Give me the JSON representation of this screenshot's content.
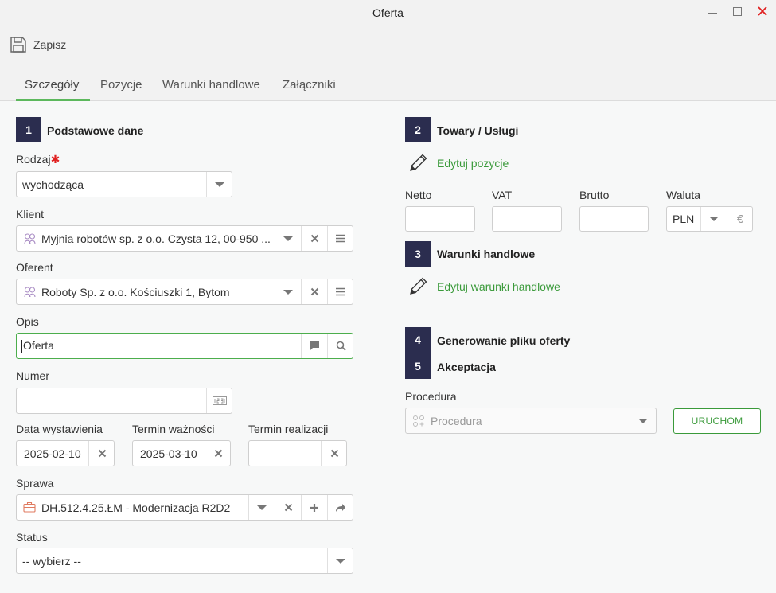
{
  "window": {
    "title": "Oferta"
  },
  "toolbar": {
    "save_label": "Zapisz"
  },
  "tabs": [
    {
      "label": "Szczegóły",
      "active": true
    },
    {
      "label": "Pozycje"
    },
    {
      "label": "Warunki handlowe"
    },
    {
      "label": "Załączniki"
    }
  ],
  "sections": {
    "s1": {
      "num": "1",
      "title": "Podstawowe dane"
    },
    "s2": {
      "num": "2",
      "title": "Towary / Usługi"
    },
    "s3": {
      "num": "3",
      "title": "Warunki handlowe"
    },
    "s4": {
      "num": "4",
      "title": "Generowanie pliku oferty"
    },
    "s5": {
      "num": "5",
      "title": "Akceptacja"
    }
  },
  "form": {
    "rodzaj": {
      "label": "Rodzaj",
      "value": "wychodząca"
    },
    "klient": {
      "label": "Klient",
      "value": "Myjnia robotów sp. z o.o. Czysta 12, 00-950 ..."
    },
    "oferent": {
      "label": "Oferent",
      "value": "Roboty Sp. z o.o. Kościuszki 1, Bytom"
    },
    "opis": {
      "label": "Opis",
      "value": "Oferta"
    },
    "numer": {
      "label": "Numer",
      "value": ""
    },
    "data_wystawienia": {
      "label": "Data wystawienia",
      "value": "2025-02-10"
    },
    "termin_waznosci": {
      "label": "Termin ważności",
      "value": "2025-03-10"
    },
    "termin_realizacji": {
      "label": "Termin realizacji",
      "value": ""
    },
    "sprawa": {
      "label": "Sprawa",
      "value": "DH.512.4.25.ŁM - Modernizacja R2D2"
    },
    "status": {
      "label": "Status",
      "value": "-- wybierz --"
    }
  },
  "towary": {
    "edit_link": "Edytuj pozycje",
    "netto_label": "Netto",
    "vat_label": "VAT",
    "brutto_label": "Brutto",
    "waluta_label": "Waluta",
    "waluta_value": "PLN",
    "currency_symbol": "€"
  },
  "warunki": {
    "edit_link": "Edytuj warunki handlowe"
  },
  "procedura": {
    "label": "Procedura",
    "placeholder": "Procedura",
    "run_label": "URUCHOM"
  },
  "colors": {
    "accent_green": "#3a9a3a",
    "section_badge": "#2b2d4f",
    "close_red": "#e02020",
    "required_red": "#e02020"
  }
}
